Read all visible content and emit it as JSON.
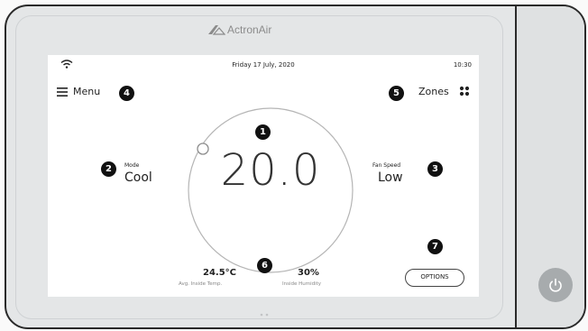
{
  "brand": {
    "name": "ActronAir"
  },
  "status_bar": {
    "date": "Friday 17 July, 2020",
    "time": "10:30"
  },
  "header": {
    "menu_label": "Menu",
    "zones_label": "Zones"
  },
  "thermostat": {
    "setpoint": "20.0",
    "mode_caption": "Mode",
    "mode_value": "Cool",
    "fan_caption": "Fan Speed",
    "fan_value": "Low"
  },
  "stats": {
    "inside_temp_value": "24.5°C",
    "inside_temp_caption": "Avg. Inside Temp.",
    "humidity_value": "30%",
    "humidity_caption": "Inside Humidity"
  },
  "options_label": "OPTIONS",
  "badges": [
    "1",
    "2",
    "3",
    "4",
    "5",
    "6",
    "7"
  ],
  "icons": [
    "wifi-icon",
    "menu-icon",
    "zones-grid-icon",
    "power-icon",
    "brand-logo-icon"
  ],
  "colors": {
    "device_body": "#e4e6e7",
    "screen": "#ffffff",
    "badge": "#111111",
    "power_button": "#a7abad"
  }
}
